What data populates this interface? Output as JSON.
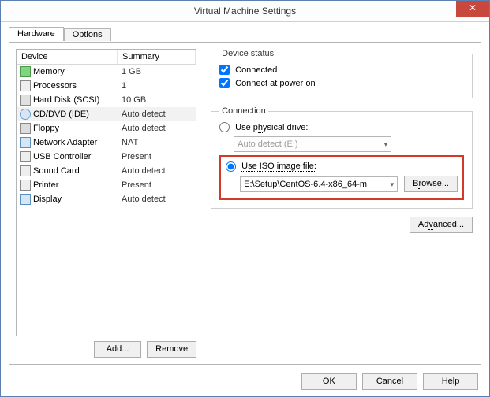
{
  "window": {
    "title": "Virtual Machine Settings"
  },
  "tabs": {
    "hardware": "Hardware",
    "options": "Options"
  },
  "list": {
    "header_device": "Device",
    "header_summary": "Summary",
    "rows": [
      {
        "name": "Memory",
        "summary": "1 GB"
      },
      {
        "name": "Processors",
        "summary": "1"
      },
      {
        "name": "Hard Disk (SCSI)",
        "summary": "10 GB"
      },
      {
        "name": "CD/DVD (IDE)",
        "summary": "Auto detect"
      },
      {
        "name": "Floppy",
        "summary": "Auto detect"
      },
      {
        "name": "Network Adapter",
        "summary": "NAT"
      },
      {
        "name": "USB Controller",
        "summary": "Present"
      },
      {
        "name": "Sound Card",
        "summary": "Auto detect"
      },
      {
        "name": "Printer",
        "summary": "Present"
      },
      {
        "name": "Display",
        "summary": "Auto detect"
      }
    ]
  },
  "buttons": {
    "add": "Add...",
    "remove": "Remove",
    "browse": "Browse...",
    "advanced": "Advanced...",
    "ok": "OK",
    "cancel": "Cancel",
    "help": "Help"
  },
  "status": {
    "legend": "Device status",
    "connected": "Connected",
    "connect_poweron": "Connect at power on"
  },
  "connection": {
    "legend": "Connection",
    "use_physical": "Use physical drive:",
    "physical_value": "Auto detect (E:)",
    "use_iso": "Use ISO image file:",
    "iso_value": "E:\\Setup\\CentOS-6.4-x86_64-m"
  }
}
